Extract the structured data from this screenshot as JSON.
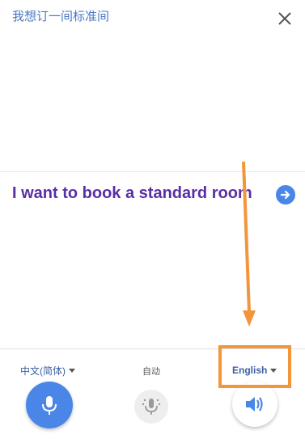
{
  "source": {
    "text": "我想订一间标准间"
  },
  "translation": {
    "text": "I want to book a standard room"
  },
  "languages": {
    "source_label": "中文(简体)",
    "auto_label": "自动",
    "target_label": "English"
  },
  "icons": {
    "close": "close-icon",
    "send": "arrow-right-icon",
    "mic": "microphone-icon",
    "auto_mic": "microphone-muted-icon",
    "speaker": "speaker-icon"
  },
  "colors": {
    "accent_blue": "#4a86e8",
    "translation_purple": "#5a2ea6",
    "annotation_orange": "#f3953a"
  }
}
